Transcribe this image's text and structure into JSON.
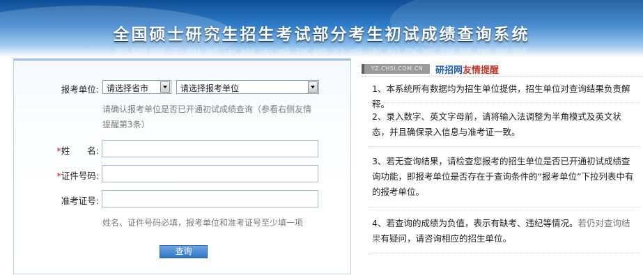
{
  "header": {
    "title": "全国硕士研究生招生考试部分考生初试成绩查询系统"
  },
  "form": {
    "unit_label": "报考单位:",
    "province_select": "请选择省市",
    "unit_select": "请选择报考单位",
    "unit_hint": "请确认报考单位是否已开通初试成绩查询（参看右侧友情提醒第3条）",
    "required_mark": "*",
    "name_label": "姓　　名:",
    "id_label": "证件号码:",
    "ticket_label": "准考证号:",
    "name_value": "",
    "id_value": "",
    "ticket_value": "",
    "fill_hint": "姓名、证件号码必填，报考单位和准考证号至少填一项",
    "query_button": "查询"
  },
  "notice": {
    "tag_text": "YZ.CHSI.COM.CN",
    "title_part1": "研招网",
    "title_part2": "友情提醒",
    "items": [
      {
        "text": "1、本系统所有数据均为招生单位提供，招生单位对查询结果负责解释。"
      },
      {
        "text": "2、录入数字、英文字母前，请将输入法调整为半角模式及英文状态，并且确保录入信息与准考证一致。"
      },
      {
        "text": "3、若无查询结果，请检查您报考的招生单位是否已开通初试成绩查询功能，即报考单位是否存在于查询条件的“报考单位”下拉列表中有的报考单位。"
      },
      {
        "text_main": "4、若查询的成绩为负值，表示有缺考、违纪等情况。",
        "text_muted": "若仍对查询结果",
        "text_tail": "有疑问，请咨询相应的招生单位。"
      }
    ]
  },
  "colors": {
    "banner_dark": "#0f4f97",
    "banner_light": "#8ec0ec",
    "required": "#e00000",
    "link_blue": "#1e5fab",
    "notice_red": "#c0392b"
  }
}
